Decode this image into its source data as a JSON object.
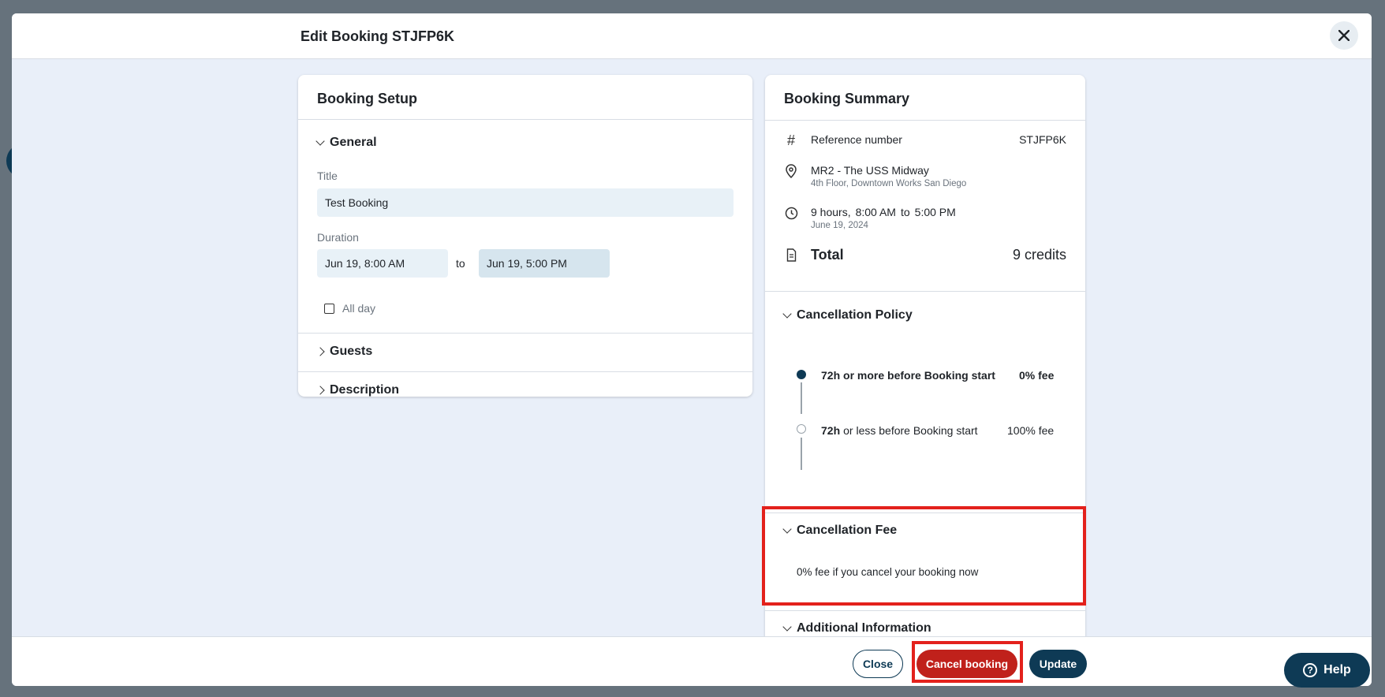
{
  "modal": {
    "title": "Edit Booking STJFP6K",
    "close_icon": "close-icon"
  },
  "setup": {
    "title": "Booking Setup",
    "general": {
      "label": "General",
      "title_label": "Title",
      "title_value": "Test Booking",
      "duration_label": "Duration",
      "start_value": "Jun 19, 8:00 AM",
      "to_label": "to",
      "end_value": "Jun 19, 5:00 PM",
      "all_day_label": "All day"
    },
    "guests_label": "Guests",
    "description_label": "Description"
  },
  "summary": {
    "title": "Booking Summary",
    "reference_label": "Reference number",
    "reference_value": "STJFP6K",
    "room_name": "MR2 - The USS Midway",
    "room_location": "4th Floor, Downtown Works San Diego",
    "time_hours": "9 hours,",
    "time_start": "8:00 AM",
    "time_to": "to",
    "time_end": "5:00 PM",
    "time_date": "June 19, 2024",
    "total_label": "Total",
    "total_value": "9 credits",
    "policy": {
      "label": "Cancellation Policy",
      "tier1_text": "72h or more before Booking start",
      "tier1_fee": "0% fee",
      "tier2_bold": "72h",
      "tier2_text": "or less before Booking start",
      "tier2_fee": "100% fee"
    },
    "fee": {
      "label": "Cancellation Fee",
      "text": "0% fee if you cancel your booking now"
    },
    "additional_label": "Additional Information"
  },
  "footer": {
    "close_label": "Close",
    "cancel_label": "Cancel booking",
    "update_label": "Update"
  },
  "help": {
    "label": "Help",
    "icon": "?"
  },
  "colors": {
    "primary": "#0e3a55",
    "danger": "#c0211b",
    "highlight": "#e3211c",
    "modal_bg": "#e9eff9"
  }
}
